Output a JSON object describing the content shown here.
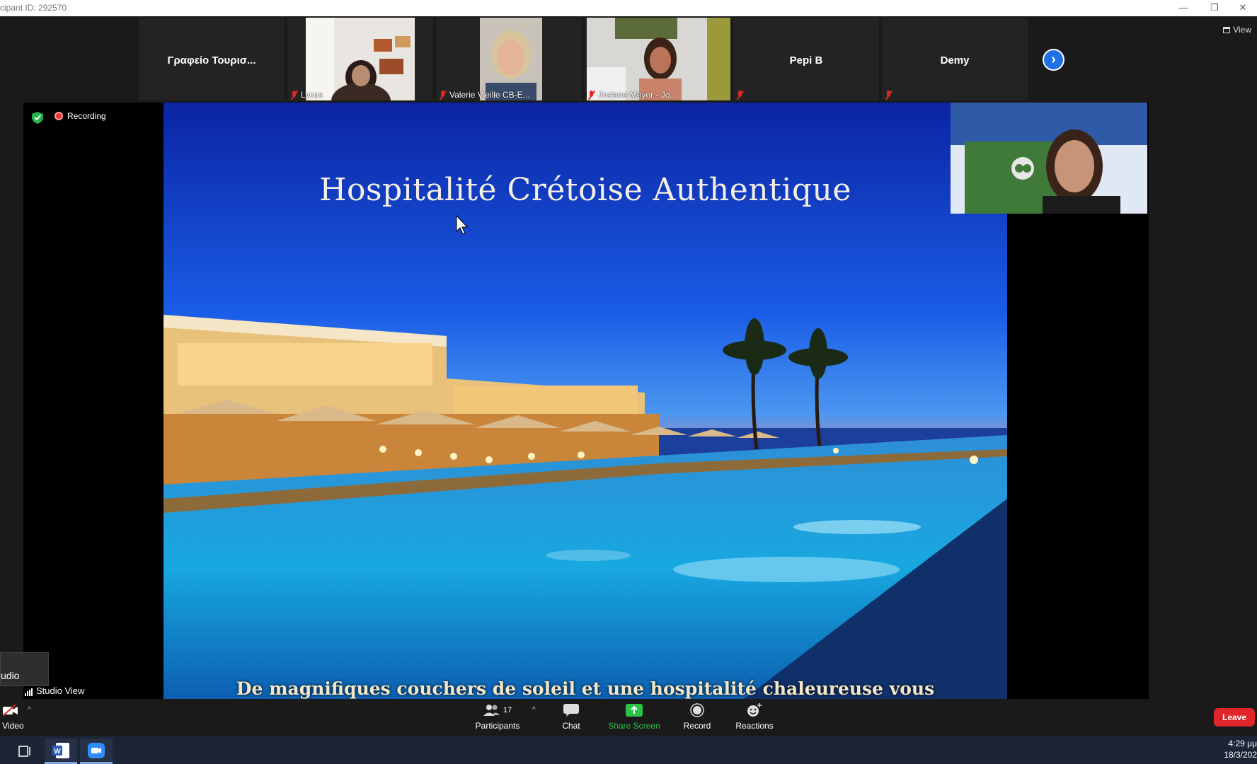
{
  "window": {
    "title": "cipant ID: 292570",
    "minimize": "—",
    "restore": "❐",
    "close": "✕"
  },
  "gallery": {
    "tiles": [
      {
        "name": "Γραφείο Τουρισ...",
        "has_video": false,
        "muted": false
      },
      {
        "name": "Lycas",
        "has_video": true,
        "muted": true
      },
      {
        "name": "Valerie Vieille CB-E...",
        "has_video": true,
        "muted": true
      },
      {
        "name": "Josiane Meyer - Jo...",
        "has_video": true,
        "muted": true
      },
      {
        "name": "Pepi B",
        "has_video": false,
        "muted": true
      },
      {
        "name": "Demy",
        "has_video": false,
        "muted": true
      }
    ],
    "next_glyph": "›",
    "view_label": "View"
  },
  "stage": {
    "recording_label": "Recording",
    "slide": {
      "title": "Hospitalité Crétoise Authentique",
      "caption": "De magnifiques couchers de soleil et une hospitalité chaleureuse vous"
    },
    "audio_popup_text": "udio",
    "studio_view_label": "Studio View"
  },
  "toolbar": {
    "video_label": "t Video",
    "participants_label": "Participants",
    "participants_count": "17",
    "chat_label": "Chat",
    "share_label": "Share Screen",
    "record_label": "Record",
    "reactions_label": "Reactions",
    "leave_label": "Leave",
    "caret": "^",
    "colors": {
      "share_green": "#2bc24a",
      "leave_red": "#e0252b"
    }
  },
  "taskbar": {
    "time": "4:29 μμ",
    "date": "18/3/202"
  }
}
